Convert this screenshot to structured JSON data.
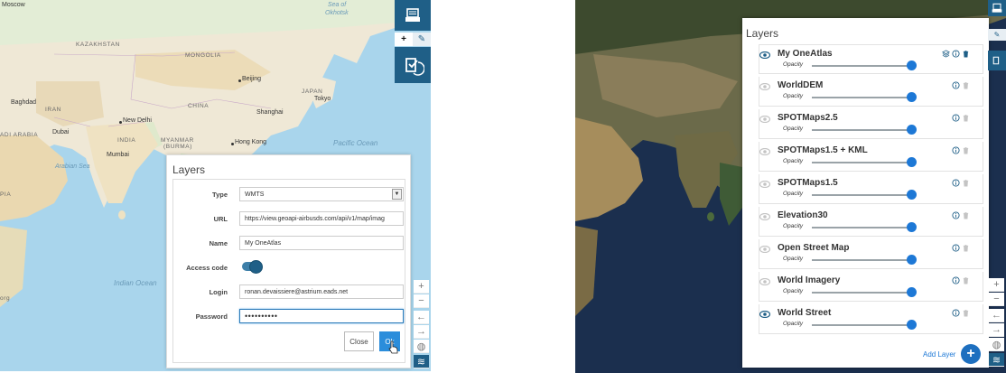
{
  "left_map": {
    "labels": {
      "moscow": "Moscow",
      "sea": "Sea of",
      "okhotsk": "Okhotsk",
      "kazakhstan": "KAZAKHSTAN",
      "mongolia": "MONGOLIA",
      "beijing": "Beijing",
      "baghdad": "Baghdad",
      "iran": "IRAN",
      "china": "CHINA",
      "japan": "JAPAN",
      "tokyo": "Tokyo",
      "shanghai": "Shanghai",
      "new_delhi": "New Delhi",
      "arabia": "ADI ARABIA",
      "dubai": "Dubai",
      "india": "INDIA",
      "myanmar": "MYANMAR",
      "burma": "(BURMA)",
      "hong_kong": "Hong Kong",
      "pacific": "Pacific Ocean",
      "mumbai": "Mumbai",
      "arabian_sea": "Arabian Sea",
      "indian_ocean": "Indian Ocean",
      "pia": "PIA",
      "org": "org"
    }
  },
  "left_toolbar": {
    "plus_label": "+",
    "pin_label": "✎"
  },
  "left_dialog": {
    "title": "Layers",
    "fields": {
      "type_label": "Type",
      "type_value": "WMTS",
      "url_label": "URL",
      "url_value": "https://view.geoapi-airbusds.com/api/v1/map/imag",
      "name_label": "Name",
      "name_value": "My OneAtlas",
      "access_label": "Access code",
      "login_label": "Login",
      "login_value": "ronan.devaissiere@astrium.eads.net",
      "password_label": "Password",
      "password_value": "••••••••••"
    },
    "close_label": "Close",
    "ok_label": "Ok"
  },
  "left_vertical_tools": {
    "zoom_in": "+",
    "zoom_out": "−",
    "back": "←",
    "forward": "→",
    "globe": "◍",
    "layers": "≋"
  },
  "right_panel": {
    "title": "Layers",
    "opacity_label": "Opacity",
    "layers": [
      {
        "name": "My OneAtlas",
        "visible": true,
        "opacity": 1.0
      },
      {
        "name": "WorldDEM",
        "visible": false,
        "opacity": 1.0
      },
      {
        "name": "SPOTMaps2.5",
        "visible": false,
        "opacity": 1.0
      },
      {
        "name": "SPOTMaps1.5 + KML",
        "visible": false,
        "opacity": 1.0
      },
      {
        "name": "SPOTMaps1.5",
        "visible": false,
        "opacity": 1.0
      },
      {
        "name": "Elevation30",
        "visible": false,
        "opacity": 1.0
      },
      {
        "name": "Open Street Map",
        "visible": false,
        "opacity": 1.0
      },
      {
        "name": "World Imagery",
        "visible": false,
        "opacity": 1.0
      },
      {
        "name": "World Street",
        "visible": true,
        "opacity": 1.0
      }
    ],
    "add_layer_label": "Add Layer",
    "add_layer_icon": "+"
  },
  "right_vertical_tools": {
    "zoom_in": "+",
    "zoom_out": "−",
    "back": "←",
    "forward": "→",
    "globe": "◍",
    "layers": "≋"
  },
  "colors": {
    "toolbar": "#1f5f87",
    "accent": "#1d78d6",
    "ok_button": "#2b8ddb"
  }
}
